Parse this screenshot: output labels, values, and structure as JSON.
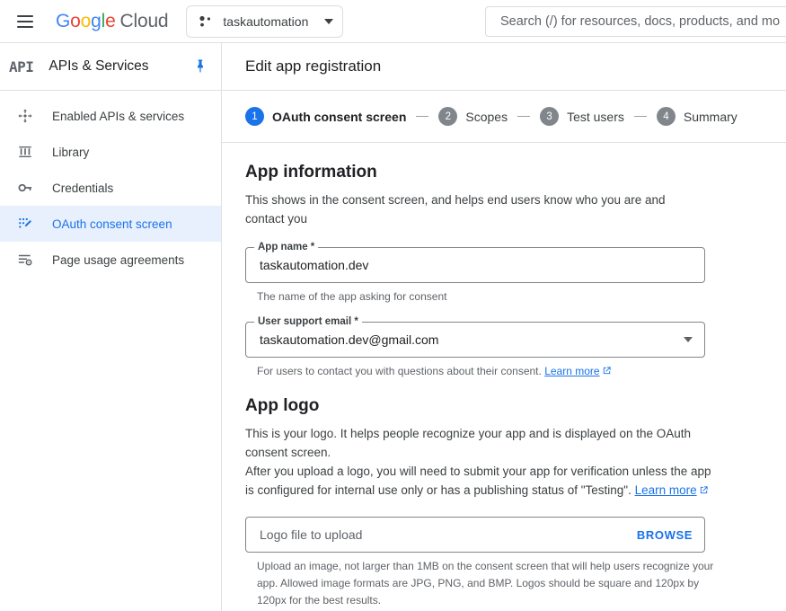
{
  "topbar": {
    "menu_icon": "hamburger-menu-icon",
    "brand_google": "Google",
    "brand_cloud": "Cloud",
    "project_icon": "project-dots-icon",
    "project_name": "taskautomation",
    "project_caret_icon": "chevron-down-icon",
    "search_placeholder": "Search (/) for resources, docs, products, and mo",
    "search_value": ""
  },
  "sidebar": {
    "logo_text": "API",
    "title": "APIs & Services",
    "pin_icon": "pin-icon",
    "items": [
      {
        "label": "Enabled APIs & services",
        "icon": "enabled-apis-icon",
        "active": false
      },
      {
        "label": "Library",
        "icon": "library-icon",
        "active": false
      },
      {
        "label": "Credentials",
        "icon": "key-icon",
        "active": false
      },
      {
        "label": "OAuth consent screen",
        "icon": "consent-screen-icon",
        "active": true
      },
      {
        "label": "Page usage agreements",
        "icon": "page-usage-agreements-icon",
        "active": false
      }
    ]
  },
  "main": {
    "page_title": "Edit app registration",
    "steps": [
      {
        "number": "1",
        "label": "OAuth consent screen",
        "active": true
      },
      {
        "number": "2",
        "label": "Scopes",
        "active": false
      },
      {
        "number": "3",
        "label": "Test users",
        "active": false
      },
      {
        "number": "4",
        "label": "Summary",
        "active": false
      }
    ],
    "app_information": {
      "heading": "App information",
      "description": "This shows in the consent screen, and helps end users know who you are and contact you",
      "app_name": {
        "label": "App name *",
        "value": "taskautomation.dev",
        "placeholder": "",
        "hint": "The name of the app asking for consent"
      },
      "user_support_email": {
        "label": "User support email *",
        "value": "taskautomation.dev@gmail.com",
        "hint_text": "For users to contact you with questions about their consent.",
        "hint_link": "Learn more",
        "caret_icon": "chevron-down-icon",
        "external_icon": "external-link-icon"
      }
    },
    "app_logo": {
      "heading": "App logo",
      "description_line1": "This is your logo. It helps people recognize your app and is displayed on the OAuth consent screen.",
      "description_line2": "After you upload a logo, you will need to submit your app for verification unless the app is configured for internal use only or has a publishing status of \"Testing\".",
      "description_link": "Learn more",
      "external_icon": "external-link-icon",
      "upload": {
        "placeholder": "Logo file to upload",
        "value": "",
        "browse_label": "BROWSE",
        "hint": "Upload an image, not larger than 1MB on the consent screen that will help users recognize your app. Allowed image formats are JPG, PNG, and BMP. Logos should be square and 120px by 120px for the best results."
      }
    }
  },
  "colors": {
    "accent_blue": "#1a73e8",
    "active_nav_bg": "#e8f0fe",
    "step_inactive": "#80868b",
    "border": "#dadce0",
    "text_primary": "#202124",
    "text_secondary": "#5f6368"
  }
}
